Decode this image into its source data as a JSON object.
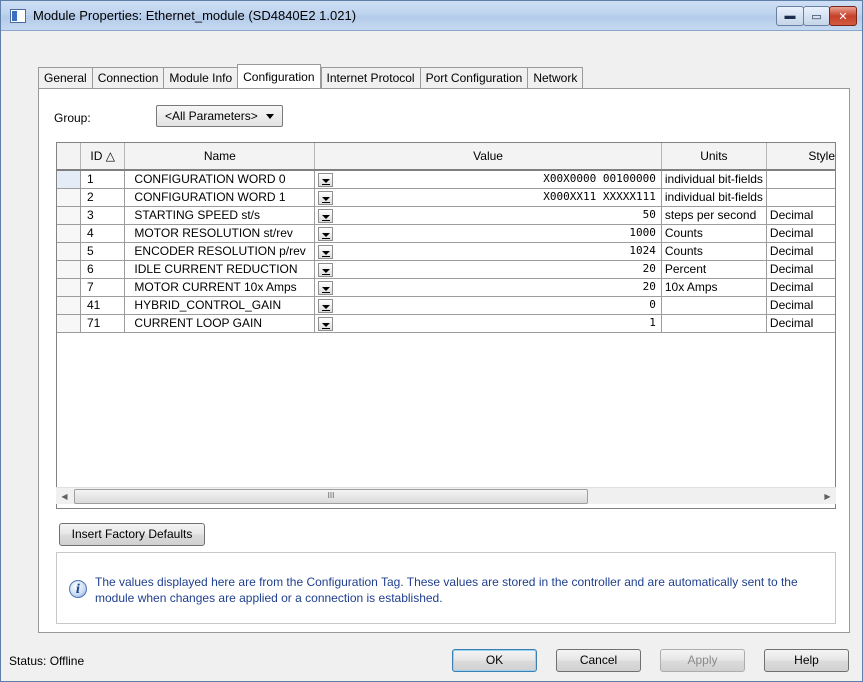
{
  "window": {
    "title": "Module Properties: Ethernet_module (SD4840E2 1.021)",
    "controls": {
      "minimize": "▬",
      "maximize": "▭",
      "close": "✕"
    }
  },
  "tabs": [
    {
      "label": "General",
      "active": false
    },
    {
      "label": "Connection",
      "active": false
    },
    {
      "label": "Module Info",
      "active": false
    },
    {
      "label": "Configuration",
      "active": true
    },
    {
      "label": "Internet Protocol",
      "active": false
    },
    {
      "label": "Port Configuration",
      "active": false
    },
    {
      "label": "Network",
      "active": false
    }
  ],
  "group": {
    "label": "Group:",
    "selected": "<All Parameters>"
  },
  "grid": {
    "columns": [
      "ID △",
      "Name",
      "Value",
      "Units",
      "Style"
    ],
    "rows": [
      {
        "id": "1",
        "name": "CONFIGURATION WORD 0",
        "value": "X00X0000 00100000",
        "units": "individual bit-fields",
        "style": ""
      },
      {
        "id": "2",
        "name": "CONFIGURATION WORD 1",
        "value": "X000XX11 XXXXX111",
        "units": "individual bit-fields",
        "style": ""
      },
      {
        "id": "3",
        "name": "STARTING SPEED st/s",
        "value": "50",
        "units": "steps per second",
        "style": "Decimal"
      },
      {
        "id": "4",
        "name": "MOTOR RESOLUTION st/rev",
        "value": "1000",
        "units": "Counts",
        "style": "Decimal"
      },
      {
        "id": "5",
        "name": "ENCODER RESOLUTION p/rev",
        "value": "1024",
        "units": "Counts",
        "style": "Decimal"
      },
      {
        "id": "6",
        "name": "IDLE CURRENT REDUCTION",
        "value": "20",
        "units": "Percent",
        "style": "Decimal"
      },
      {
        "id": "7",
        "name": "MOTOR CURRENT 10x Amps",
        "value": "20",
        "units": "10x Amps",
        "style": "Decimal"
      },
      {
        "id": "41",
        "name": "HYBRID_CONTROL_GAIN",
        "value": "0",
        "units": "",
        "style": "Decimal"
      },
      {
        "id": "71",
        "name": "CURRENT LOOP GAIN",
        "value": "1",
        "units": "",
        "style": "Decimal"
      }
    ]
  },
  "scrollbar": {
    "left_arrow": "◀",
    "right_arrow": "▶",
    "grip": "III"
  },
  "buttons": {
    "factory_defaults": "Insert Factory Defaults",
    "ok": "OK",
    "cancel": "Cancel",
    "apply": "Apply",
    "help": "Help"
  },
  "info": {
    "icon": "i",
    "text": "The values displayed here are from the Configuration Tag. These values are stored in the controller and are automatically sent to the module when changes are applied or a connection is established."
  },
  "status": "Status:  Offline"
}
